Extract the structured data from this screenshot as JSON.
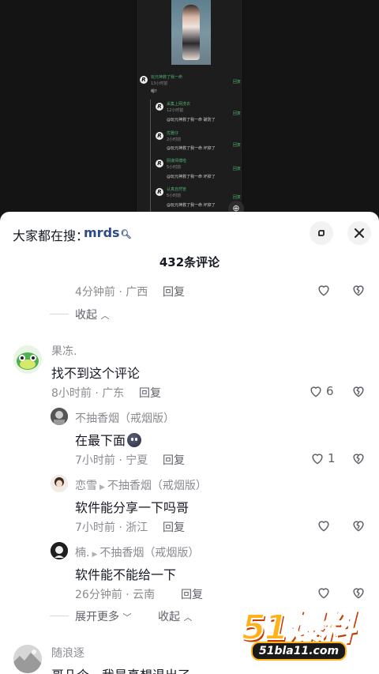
{
  "video": {
    "mini_comments": [
      {
        "name": "玩元神救了我一命",
        "time": "13小时前",
        "text": "嗯?",
        "reply": "回复"
      },
      {
        "name": "采集上网洗衣",
        "time": "12小时前",
        "text": "@玩元神救了我一命 破防了",
        "reply": "回复"
      },
      {
        "name": "优雅仔",
        "time": "2小时前",
        "text": "@玩元神救了我一命 坏掉了",
        "reply": "回复"
      },
      {
        "name": "阴谋师傅啦",
        "time": "5小时前",
        "text": "@玩元神救了我一命 坏掉了",
        "reply": "回复"
      },
      {
        "name": "认真自然管",
        "time": "5小时前",
        "text": "@玩元神救了我一命 坏掉了",
        "reply": "回复"
      }
    ]
  },
  "panel": {
    "search_prefix": "大家都在搜：",
    "search_term": "mrds",
    "comment_count": "432条评论",
    "expand_icon": "expand-icon",
    "close_icon": "close-icon"
  },
  "comments": {
    "prev": {
      "meta": "4分钟前 · 广西",
      "reply": "回复",
      "fold": "收起"
    },
    "main": {
      "author": "果冻.",
      "text": "找不到这个评论",
      "meta": "8小时前 · 广东",
      "reply": "回复",
      "likes": "6"
    },
    "replies": [
      {
        "author": "不抽香烟（戒烟版）",
        "text": "在最下面",
        "meta": "7小时前 · 宁夏",
        "reply": "回复",
        "likes": "1"
      },
      {
        "author": "恋雪",
        "to": "不抽香烟（戒烟版）",
        "text": "软件能分享一下吗哥",
        "meta": "7小时前 · 浙江",
        "reply": "回复",
        "likes": ""
      },
      {
        "author": "楠.",
        "to": "不抽香烟（戒烟版）",
        "text": "软件能不能给一下",
        "meta": "26分钟前 · 云南",
        "reply": "回复",
        "likes": ""
      }
    ],
    "more": {
      "expand": "展开更多",
      "collapse": "收起"
    },
    "next": {
      "author": "随浪逐",
      "text": "哥几个，我是真想退出了"
    }
  },
  "watermark": {
    "brand": "51爆料",
    "site": "51bla11.com"
  }
}
